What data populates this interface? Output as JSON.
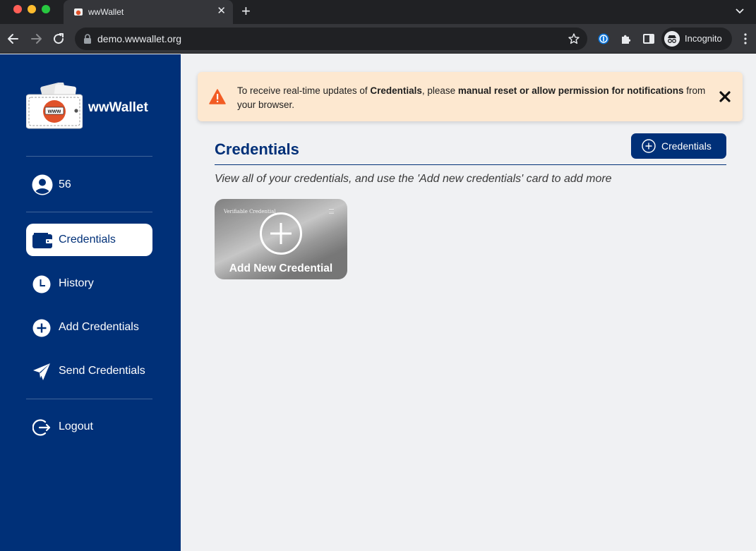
{
  "browser": {
    "tab_title": "wwWallet",
    "tab_close": "✕",
    "new_tab": "+",
    "url": "demo.wwwallet.org",
    "incognito_label": "Incognito"
  },
  "sidebar": {
    "brand": "wwWallet",
    "logo_text": "www",
    "user_id": "56",
    "items": [
      {
        "label": "Credentials",
        "icon": "wallet-icon",
        "active": true
      },
      {
        "label": "History",
        "icon": "clock-icon",
        "active": false
      },
      {
        "label": "Add Credentials",
        "icon": "plus-circle-icon",
        "active": false
      },
      {
        "label": "Send Credentials",
        "icon": "paper-plane-icon",
        "active": false
      }
    ],
    "logout_label": "Logout"
  },
  "alert": {
    "text_1": "To receive real-time updates of ",
    "bold_1": "Credentials",
    "text_2": ", please ",
    "bold_2": "manual reset or allow permission for notifications",
    "text_3": " from your browser."
  },
  "main": {
    "title": "Credentials",
    "add_button_label": "Credentials",
    "subtitle": "View all of your credentials, and use the 'Add new credentials' card to add more",
    "card": {
      "tag": "Verifiable Credential",
      "label": "Add New Credential"
    }
  },
  "colors": {
    "primary": "#003078",
    "alert_bg": "#fde8d0",
    "alert_icon": "#f25c24",
    "logo_accent": "#e0522a"
  }
}
